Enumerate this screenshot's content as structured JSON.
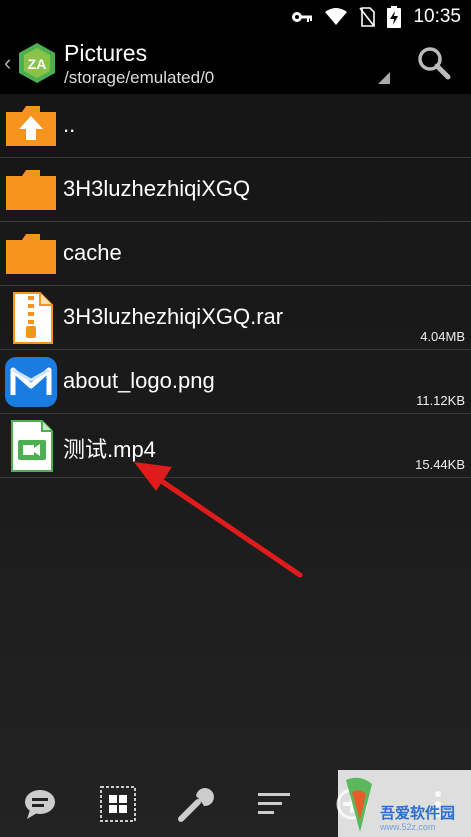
{
  "status_bar": {
    "time": "10:35",
    "icons": [
      "key-icon",
      "wifi-icon",
      "no-sim-icon",
      "battery-charging-icon"
    ]
  },
  "app_bar": {
    "title": "Pictures",
    "path": "/storage/emulated/0",
    "logo_text": "ZA",
    "icons": [
      "back-chevron-icon",
      "zarchiver-logo-icon",
      "path-dropdown-icon",
      "search-icon"
    ]
  },
  "files": [
    {
      "name": "..",
      "size": "",
      "icon": "folder-up-icon"
    },
    {
      "name": "3H3luzhezhiqiXGQ",
      "size": "",
      "icon": "folder-icon"
    },
    {
      "name": "cache",
      "size": "",
      "icon": "folder-icon"
    },
    {
      "name": "3H3luzhezhiqiXGQ.rar",
      "size": "4.04MB",
      "icon": "archive-icon"
    },
    {
      "name": "about_logo.png",
      "size": "11.12KB",
      "icon": "image-app-icon"
    },
    {
      "name": "测试.mp4",
      "size": "15.44KB",
      "icon": "video-file-icon"
    }
  ],
  "toolbar": {
    "icons": [
      "chat-icon",
      "grid-icon",
      "wrench-icon",
      "sort-icon",
      "add-icon",
      "more-icon"
    ]
  },
  "watermark": {
    "text": "吾爱软件园",
    "url": "www.52z.com"
  },
  "colors": {
    "folder": "#f7941d",
    "accent_green": "#4caf50",
    "arrow": "#e01b1b",
    "logo_blue": "#1a7be0"
  }
}
